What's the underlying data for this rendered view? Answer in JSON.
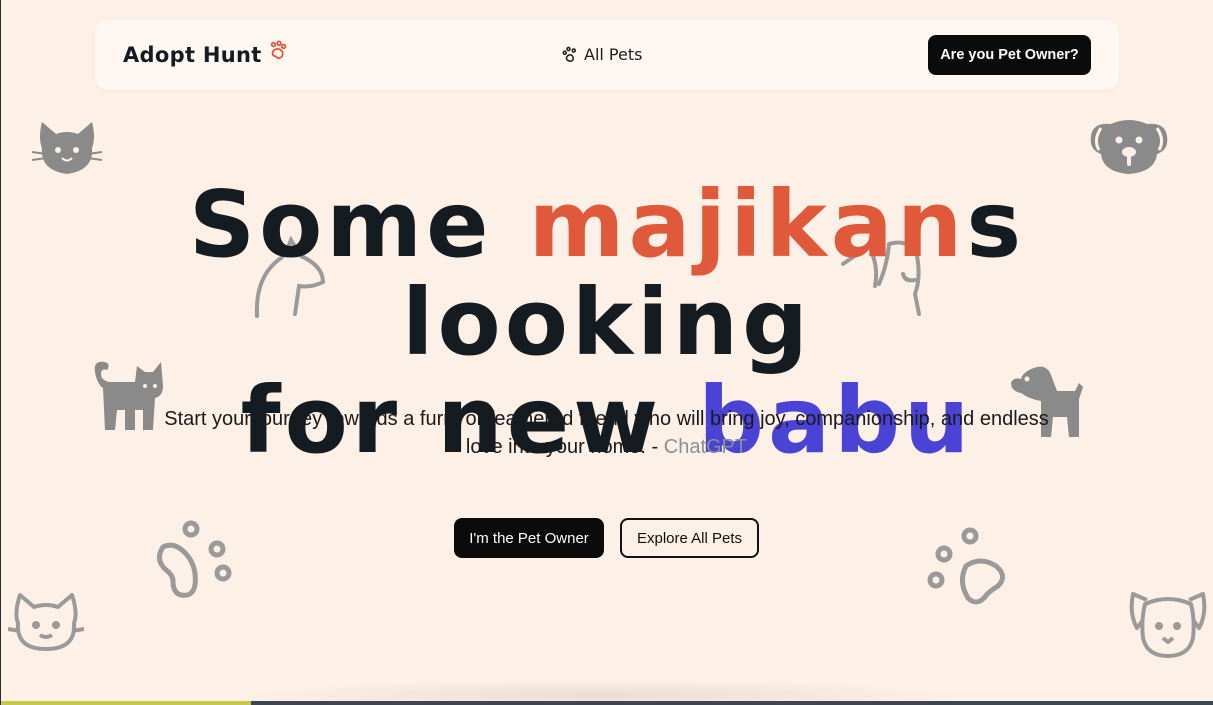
{
  "nav": {
    "brand": "Adopt Hunt",
    "brand_icon": "paw-icon",
    "all_pets": "All Pets",
    "all_pets_icon": "paw-icon",
    "owner_button": "Are you Pet Owner?"
  },
  "hero": {
    "line1_a": "Some ",
    "line1_b": "majikan",
    "line1_c": "s looking",
    "line2_a": "for new ",
    "line2_b": "babu",
    "subtitle": "Start your journey towards a furry or feathered friend who will bring joy, companionship, and endless love into your home. - ",
    "credit": "ChatGPT",
    "primary_button": "I'm the Pet Owner",
    "secondary_button": "Explore All Pets"
  },
  "colors": {
    "background": "#fdf0e6",
    "accent_orange": "#e0593a",
    "accent_purple": "#4b43d6",
    "decor_gray": "#8a8a8a"
  },
  "decorations": [
    "cat-face-icon",
    "dog-face-icon",
    "cat-outline-icon",
    "dog-outline-icon",
    "cat-standing-icon",
    "dog-standing-icon",
    "paw-outline-icon",
    "paw-outline-icon",
    "cat-face-outline-icon",
    "dog-face-outline-icon"
  ]
}
